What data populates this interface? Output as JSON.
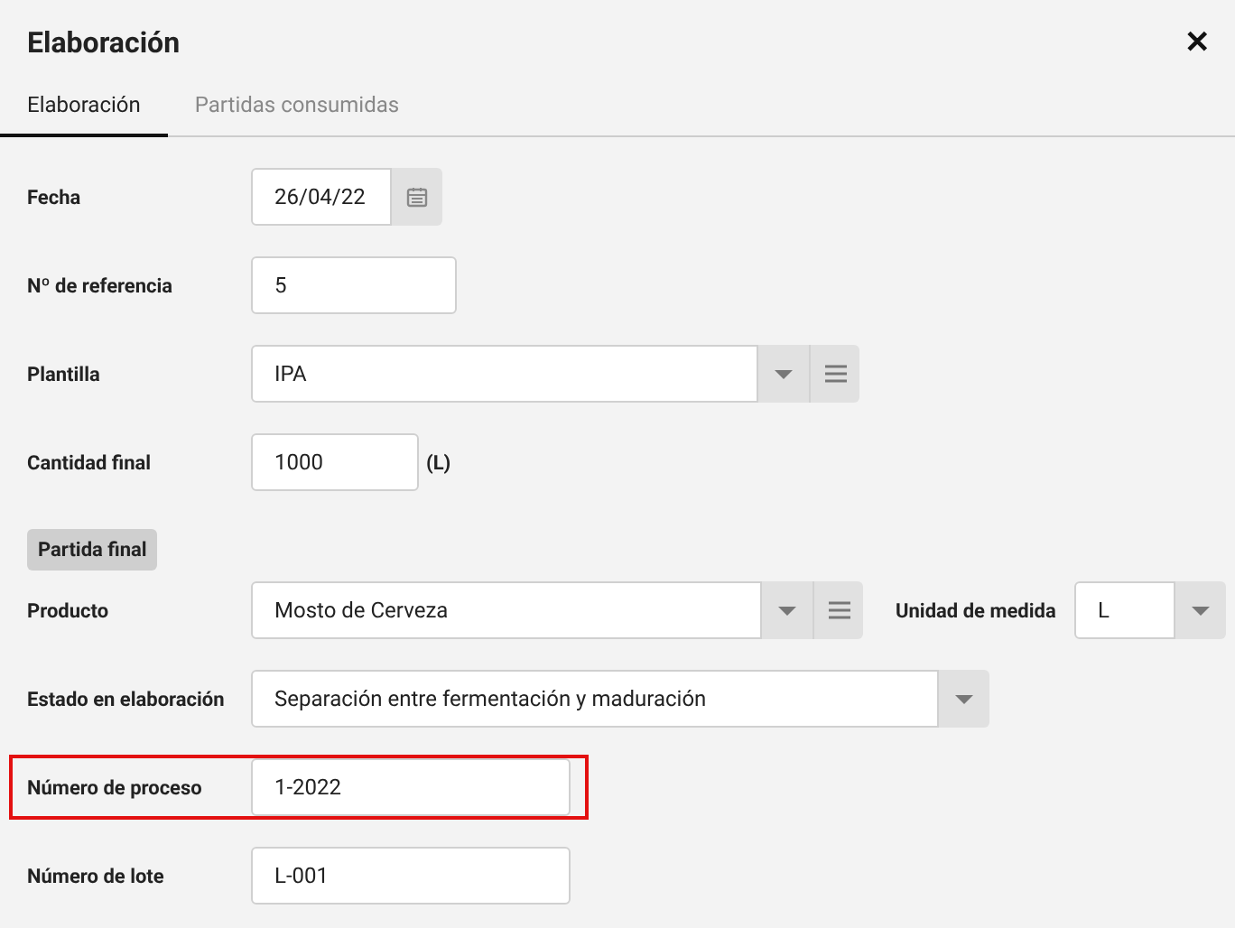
{
  "dialog": {
    "title": "Elaboración",
    "close": "✕"
  },
  "tabs": [
    {
      "label": "Elaboración",
      "selected": true
    },
    {
      "label": "Partidas consumidas",
      "selected": false
    }
  ],
  "rows": [
    {
      "kind": "date",
      "label": "Fecha",
      "value": "26/04/22",
      "highlighted": false
    },
    {
      "kind": "text",
      "label": "Nº de referencia",
      "value": "5",
      "highlighted": false
    },
    {
      "kind": "select",
      "label": "Plantilla",
      "value": "IPA",
      "menu": true,
      "highlighted": false
    },
    {
      "kind": "text",
      "label": "Cantidad final",
      "value": "1000",
      "unit": "(L)",
      "highlighted": false
    },
    {
      "kind": "section",
      "label": "Partida final"
    },
    {
      "kind": "select",
      "label": "Producto",
      "value": "Mosto de Cerveza",
      "menu": true,
      "highlighted": false,
      "extra": {
        "label": "Unidad de medida",
        "value": "L"
      }
    },
    {
      "kind": "select",
      "label": "Estado en elaboración",
      "value": "Separación entre fermentación y maduración",
      "menu": false,
      "highlighted": false
    },
    {
      "kind": "text",
      "label": "Número de proceso",
      "value": "1-2022",
      "highlighted": true
    },
    {
      "kind": "text",
      "label": "Número de lote",
      "value": "L-001",
      "highlighted": false
    }
  ]
}
